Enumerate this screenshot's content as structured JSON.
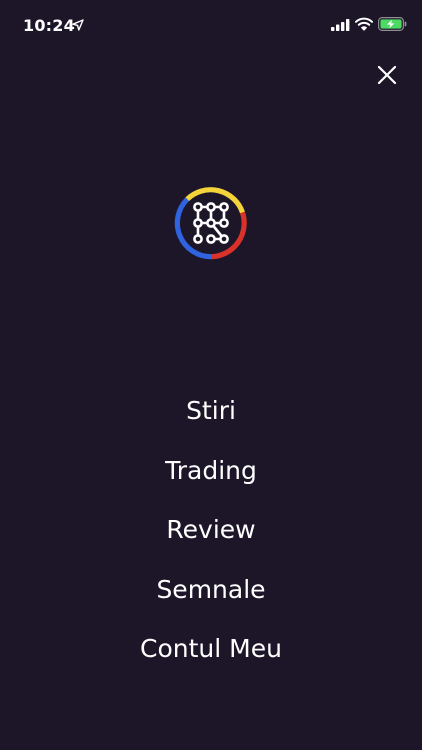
{
  "status_bar": {
    "time": "10:24",
    "icons": [
      "location-arrow-icon",
      "cellular-signal-icon",
      "wifi-icon",
      "battery-charging-icon"
    ],
    "battery_color": "#4cd964"
  },
  "header": {
    "close_icon": "close-icon"
  },
  "logo": {
    "icon": "app-logo-icon",
    "colors": [
      "#f5d33b",
      "#d8322b",
      "#2f63e0"
    ]
  },
  "menu": {
    "items": [
      {
        "label": "Stiri"
      },
      {
        "label": "Trading"
      },
      {
        "label": "Review"
      },
      {
        "label": "Semnale"
      },
      {
        "label": "Contul Meu"
      }
    ]
  },
  "theme": {
    "background": "#1c1628",
    "text": "#ffffff"
  }
}
